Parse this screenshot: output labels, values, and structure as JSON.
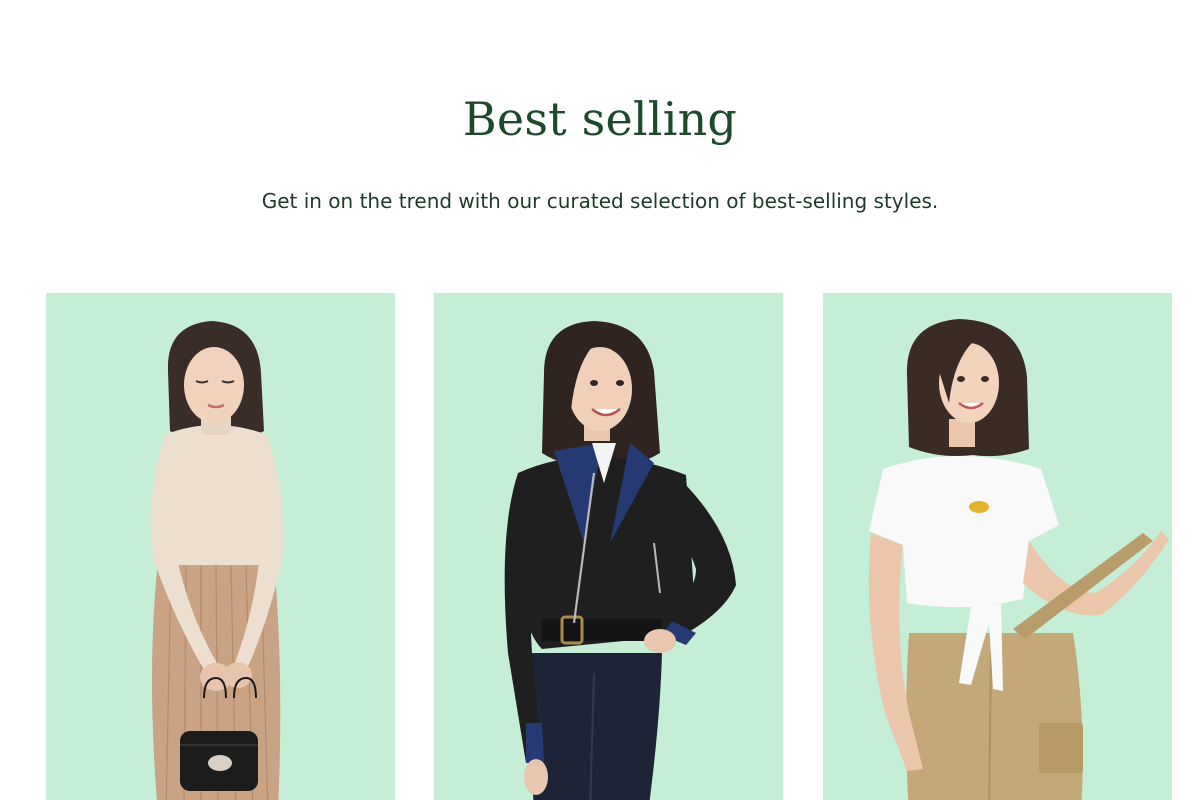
{
  "section": {
    "title": "Best selling",
    "subtitle": "Get in on the trend with our curated selection of best-selling styles."
  },
  "products": [
    {
      "outfit": "cream turtleneck and knit skirt with black handbag"
    },
    {
      "outfit": "black leather biker jacket with denim jeans"
    },
    {
      "outfit": "white tie-front tee with khaki cargo pants"
    }
  ],
  "colors": {
    "title": "#1d4a2c",
    "subtitle": "#1f3a29",
    "card_background": "#c4eed5"
  }
}
